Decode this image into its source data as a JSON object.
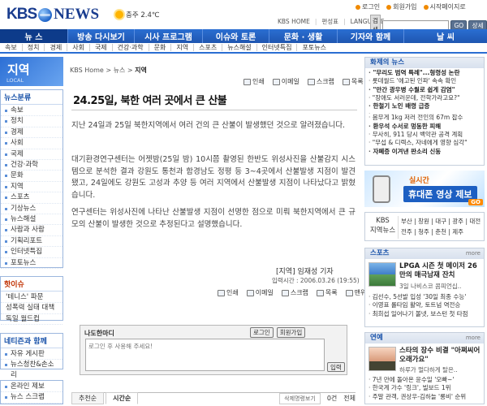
{
  "header": {
    "logo_kbs": "KBS",
    "logo_news": "NEWS",
    "weather": "충주 2.4℃",
    "util_links": [
      "로그인",
      "회원가입",
      "시작페이지로"
    ],
    "links": [
      "KBS HOME",
      "편성표",
      "LANGUAGE"
    ],
    "search_label": "검색",
    "search_placeholder": "",
    "search_go": "GO",
    "search_detail": "상세검색"
  },
  "nav": {
    "main": [
      "뉴 스",
      "방송 다시보기",
      "시사 프로그램",
      "이슈와 토론",
      "문화 · 생활",
      "기자와 함께",
      "날 씨"
    ],
    "sub": [
      "속보",
      "정치",
      "경제",
      "사회",
      "국제",
      "건강·과학",
      "문화",
      "지역",
      "스포츠",
      "뉴스해설",
      "인터넷특집",
      "포토뉴스"
    ]
  },
  "left": {
    "region_title": "지역",
    "region_sub": "LOCAL",
    "category_header": "뉴스분류",
    "categories": [
      "속보",
      "정치",
      "경제",
      "사회",
      "국제",
      "건강·과학",
      "문화",
      "지역",
      "스포츠",
      "기상뉴스",
      "뉴스해설",
      "사람과 사람",
      "기획리포트",
      "인터넷특집",
      "포토뉴스"
    ],
    "best_header": "핫이슈",
    "best": [
      "'테니스' 파문",
      "성폭력 실태 대책",
      "독일 월드컵"
    ],
    "together_header": "네티즌과 함께",
    "together": [
      "자유 게시판",
      "뉴스청찬&손소리"
    ],
    "more_header": [
      "온라인 제보",
      "뉴스 스크랩"
    ]
  },
  "article": {
    "breadcrumb_prefix": "KBS Home > 뉴스 >",
    "breadcrumb_current": "지역",
    "tools": [
      "인쇄",
      "이메일",
      "스크랩",
      "목록"
    ],
    "tools_bottom": [
      "인쇄",
      "이메일",
      "스크랩",
      "목록",
      "맨위로"
    ],
    "title": "24.25일, 북한 여러 곳에서 큰 산불",
    "paragraphs": [
      "지난 24일과 25일 북한지역에서 여러 건의 큰 산불이 발생했던 것으로 알려졌습니다.",
      "대기환경연구센터는 어젯밤(25일 밤) 10시쯤 촬영된 한반도 위성사진을 산불감지 시스템으로 분석한 결과 강원도 통천과 함경남도 정평 등 3~4곳에서 산불발생 지점이 발견됐고, 24일에도 강원도 고성과 추양 등 여러 지역에서 산불발생 지점이 나타났다고 밝혔습니다.",
      "연구센터는 위성사진에 나타난 산불발생 지점이 선명한 점으로 미뤄 북한지역에서 큰 규모의 산불이 발생한 것으로 추정된다고 설명했습니다."
    ],
    "byline": "[지역] 임재성 기자",
    "dateline": "입력시간 : 2006.03.26 (19:55)"
  },
  "comment": {
    "label": "나도한마디",
    "login": "로그인",
    "signup": "회원가입",
    "placeholder": "로그인 후 사용해 주세요!",
    "submit": "입력",
    "tabs": [
      "추천순",
      "시간순"
    ],
    "right_links": [
      "삭제명령보기"
    ],
    "count": "0건",
    "list_label": "전체"
  },
  "right": {
    "hot_header": "화제의 뉴스",
    "hot": [
      {
        "text": "\"무리도 범역 특례\"...형령성 논란",
        "bold": true
      },
      {
        "text": "롯데월드 '에고된 인파' 속속 확인",
        "bold": false
      },
      {
        "text": "\"만간 광우병 수월로 쉽게 감염\"",
        "bold": true
      },
      {
        "text": "\"장애도 서러운데, 전학가라고요?\"",
        "bold": false
      },
      {
        "text": "한철기 노인 배령 급증",
        "bold": true
      },
      {
        "text": "",
        "bold": false
      },
      {
        "text": "몸무게 1kg 저러 전인의 67m 잡수",
        "bold": false
      },
      {
        "text": "환우석 수서로 멍동한 피해",
        "bold": true
      },
      {
        "text": "무사히, 911 당시 백악관 공격 계획",
        "bold": false
      },
      {
        "text": "\"무섭 & 디렉스, 자네에게 영향 심각\"",
        "bold": false
      },
      {
        "text": "자폐증 이겨낸 판소리 신동",
        "bold": true
      }
    ],
    "ad_line1": "실시간",
    "ad_line2": "휴대폰 영상 제보",
    "ad_go": "GO",
    "region_logo": [
      "KBS",
      "지역뉴스"
    ],
    "region_cities": "부산 | 창원 | 대구 | 광주 | 대전 전주 | 청주 | 춘천 | 제주",
    "sports_header": "스포츠",
    "sports_feature": "LPGA 시즌 첫 메이저 26만의 매극남재 잔치",
    "sports_feature_sub": "3일 나비스코 콤피언십..",
    "sports_list": [
      "김선수, 5선발 입성 '30일 최종 수능'",
      "이영표 롤타임 활약, 토트넘 역전승",
      "최희섭 일어나기 볼넷, 보스턴 첫 타점"
    ],
    "ent_header": "연예",
    "ent_feature": "스타의 장수 비결 \"아쩌씨어 오래가요\"",
    "ent_feature_sub": "하루가 멀다하게 탈은..",
    "ent_list": [
      "7년 만에 돌아온 윤수일 '오빠~'",
      "한국계 가수 '링크', 빌보드 1위",
      "주말 관객, 권상우-김하늘 '롱비' 순위"
    ],
    "more": "more"
  }
}
